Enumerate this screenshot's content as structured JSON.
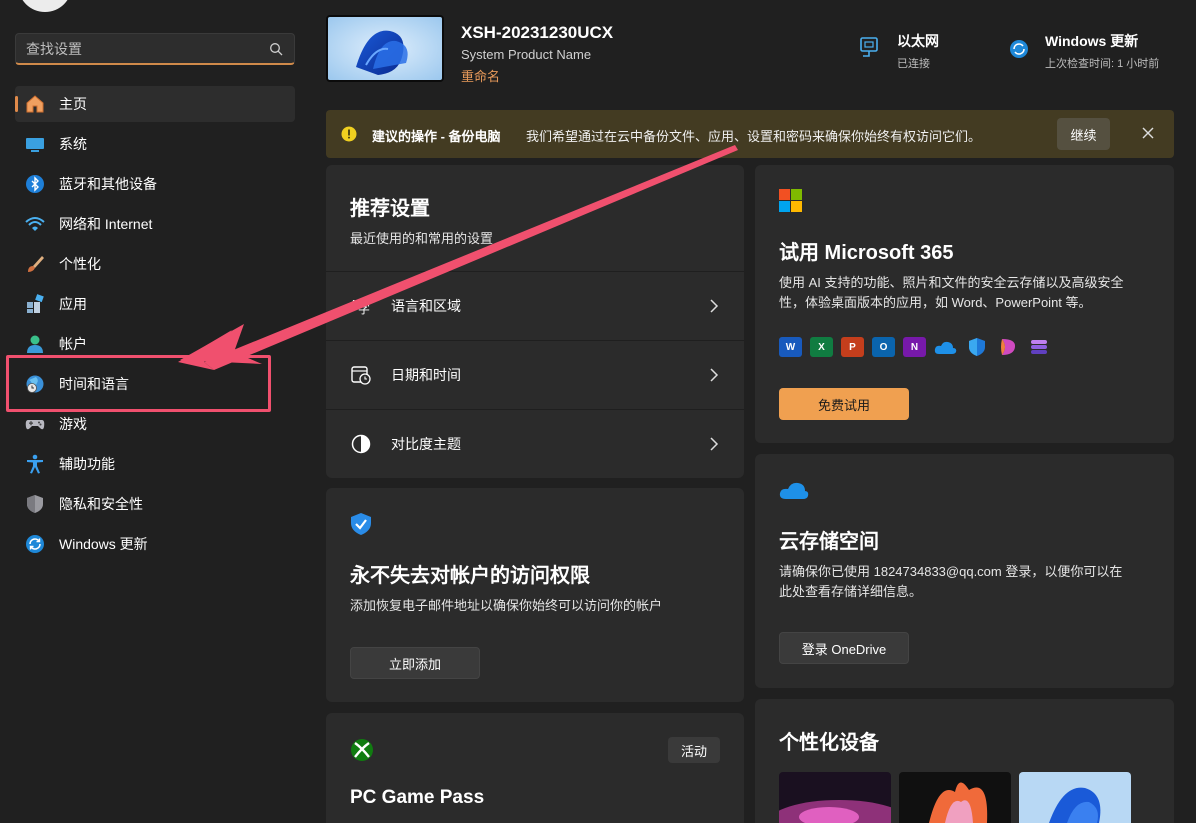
{
  "sidebar": {
    "search_placeholder": "查找设置",
    "items": [
      {
        "label": "主页",
        "icon": "home-icon"
      },
      {
        "label": "系统",
        "icon": "system-icon"
      },
      {
        "label": "蓝牙和其他设备",
        "icon": "bluetooth-icon"
      },
      {
        "label": "网络和 Internet",
        "icon": "wifi-icon"
      },
      {
        "label": "个性化",
        "icon": "brush-icon"
      },
      {
        "label": "应用",
        "icon": "apps-icon"
      },
      {
        "label": "帐户",
        "icon": "account-icon"
      },
      {
        "label": "时间和语言",
        "icon": "globe-clock-icon"
      },
      {
        "label": "游戏",
        "icon": "gamepad-icon"
      },
      {
        "label": "辅助功能",
        "icon": "accessibility-icon"
      },
      {
        "label": "隐私和安全性",
        "icon": "shield-icon"
      },
      {
        "label": "Windows 更新",
        "icon": "update-icon"
      }
    ]
  },
  "header": {
    "device_name": "XSH-20231230UCX",
    "device_model": "System Product Name",
    "rename_label": "重命名",
    "network": {
      "title": "以太网",
      "status": "已连接"
    },
    "update": {
      "title": "Windows 更新",
      "status": "上次检查时间: 1 小时前"
    }
  },
  "banner": {
    "title": "建议的操作 - 备份电脑",
    "text": "我们希望通过在云中备份文件、应用、设置和密码来确保你始终有权访问它们。",
    "button": "继续"
  },
  "recommended": {
    "title": "推荐设置",
    "subtitle": "最近使用的和常用的设置",
    "rows": [
      {
        "label": "语言和区域",
        "icon": "language-icon"
      },
      {
        "label": "日期和时间",
        "icon": "calendar-clock-icon"
      },
      {
        "label": "对比度主题",
        "icon": "contrast-icon"
      }
    ]
  },
  "m365": {
    "title": "试用 Microsoft 365",
    "text_line1": "使用 AI 支持的功能、照片和文件的安全云存储以及高级安全",
    "text_line2": "性，体验桌面版本的应用，如 Word、PowerPoint 等。",
    "button": "免费试用"
  },
  "account": {
    "title": "永不失去对帐户的访问权限",
    "text": "添加恢复电子邮件地址以确保你始终可以访问你的帐户",
    "button": "立即添加"
  },
  "cloud": {
    "title": "云存储空间",
    "text_line1": "请确保你已使用 1824734833@qq.com 登录，以便你可以在",
    "text_line2": "此处查看存储详细信息。",
    "button": "登录 OneDrive"
  },
  "gamepass": {
    "title": "PC Game Pass",
    "badge": "活动"
  },
  "personalize": {
    "title": "个性化设备"
  },
  "colors": {
    "accent": "#e08a4a",
    "highlight": "#f0506e",
    "banner_bg": "#433b22"
  }
}
